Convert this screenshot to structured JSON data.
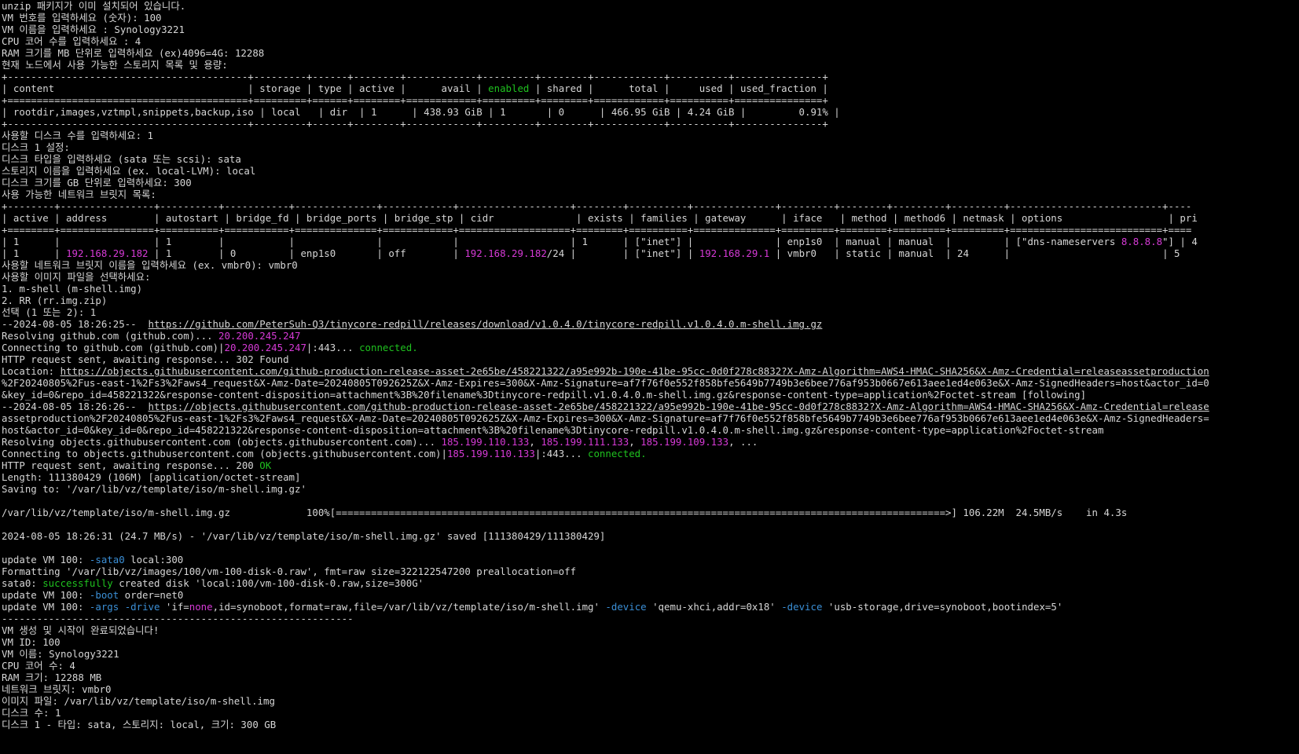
{
  "colors": {
    "background": "#000000",
    "text": "#d6d6d6",
    "magenta": "#d63ad6",
    "green": "#1fc21f",
    "blue": "#3b8fd6"
  },
  "lines": [
    [
      {
        "t": "unzip 패키지가 이미 설치되어 있습니다."
      }
    ],
    [
      {
        "t": "VM 번호를 입력하세요 (숫자): 100"
      }
    ],
    [
      {
        "t": "VM 이름을 입력하세요 : Synology3221"
      }
    ],
    [
      {
        "t": "CPU 코어 수를 입력하세요 : 4"
      }
    ],
    [
      {
        "t": "RAM 크기를 MB 단위로 입력하세요 (ex)4096=4G: 12288"
      }
    ],
    [
      {
        "t": "현재 노드에서 사용 가능한 스토리지 목록 및 용량:"
      }
    ],
    [
      {
        "t": "+-----------------------------------------+---------+------+--------+------------+---------+--------+------------+----------+---------------+"
      }
    ],
    [
      {
        "t": "| content                                 | storage | type | active |      avail | "
      },
      {
        "t": "enabled",
        "c": "green"
      },
      {
        "t": " | shared |      total |     used | used_fraction |"
      }
    ],
    [
      {
        "t": "+=========================================+=========+======+========+============+=========+========+============+==========+===============+"
      }
    ],
    [
      {
        "t": "| rootdir,images,vztmpl,snippets,backup,iso | local   | dir  | 1      | 438.93 GiB | 1       | 0      | 466.95 GiB | 4.24 GiB |         0.91% |"
      }
    ],
    [
      {
        "t": "+-----------------------------------------+---------+------+--------+------------+---------+--------+------------+----------+---------------+"
      }
    ],
    [
      {
        "t": "사용할 디스크 수를 입력하세요: 1"
      }
    ],
    [
      {
        "t": "디스크 1 설정:"
      }
    ],
    [
      {
        "t": "디스크 타입을 입력하세요 (sata 또는 scsi): sata"
      }
    ],
    [
      {
        "t": "스토리지 이름을 입력하세요 (ex. local-LVM): local"
      }
    ],
    [
      {
        "t": "디스크 크기를 GB 단위로 입력하세요: 300"
      }
    ],
    [
      {
        "t": "사용 가능한 네트워크 브릿지 목록:"
      }
    ],
    [
      {
        "t": "+--------+----------------+----------+-----------+--------------+------------+-------------------+--------+----------+--------------+---------+--------+---------+---------+--------------------------+----"
      }
    ],
    [
      {
        "t": "| active | address        | autostart | bridge_fd | bridge_ports | bridge_stp | cidr              | exists | families | gateway      | iface   | method | method6 | netmask | options                  | pri"
      }
    ],
    [
      {
        "t": "+========+================+==========+===========+==============+============+===================+========+==========+==============+=========+========+=========+=========+==========================+===="
      }
    ],
    [
      {
        "t": "| 1      |                | 1        |           |              |            |                   | 1      | [\"inet\"] |              | enp1s0  | manual | manual  |         | [\"dns-nameservers "
      },
      {
        "t": "8.8.8.8",
        "c": "magenta"
      },
      {
        "t": "\"] | 4"
      }
    ],
    [
      {
        "t": "| 1      | "
      },
      {
        "t": "192.168.29.182",
        "c": "magenta"
      },
      {
        "t": " | 1        | 0         | enp1s0       | off        | "
      },
      {
        "t": "192.168.29.182",
        "c": "magenta"
      },
      {
        "t": "/24 |        | [\"inet\"] | "
      },
      {
        "t": "192.168.29.1",
        "c": "magenta"
      },
      {
        "t": " | vmbr0   | static | manual  | 24      |                          | 5"
      }
    ],
    [
      {
        "t": "사용할 네트워크 브릿지 이름을 입력하세요 (ex. vmbr0): vmbr0"
      }
    ],
    [
      {
        "t": "사용할 이미지 파일을 선택하세요:"
      }
    ],
    [
      {
        "t": "1. m-shell (m-shell.img)"
      }
    ],
    [
      {
        "t": "2. RR (rr.img.zip)"
      }
    ],
    [
      {
        "t": "선택 (1 또는 2): 1"
      }
    ],
    [
      {
        "t": "--2024-08-05 18:26:25--  "
      },
      {
        "t": "https://github.com/PeterSuh-Q3/tinycore-redpill/releases/download/v1.0.4.0/tinycore-redpill.v1.0.4.0.m-shell.img.gz",
        "c": "url"
      }
    ],
    [
      {
        "t": "Resolving github.com (github.com)... "
      },
      {
        "t": "20.200.245.247",
        "c": "magenta"
      }
    ],
    [
      {
        "t": "Connecting to github.com (github.com)|"
      },
      {
        "t": "20.200.245.247",
        "c": "magenta"
      },
      {
        "t": "|:443... "
      },
      {
        "t": "connected.",
        "c": "green"
      }
    ],
    [
      {
        "t": "HTTP request sent, awaiting response... 302 Found"
      }
    ],
    [
      {
        "t": "Location: "
      },
      {
        "t": "https://objects.githubusercontent.com/github-production-release-asset-2e65be/458221322/a95e992b-190e-41be-95cc-0d0f278c8832?X-Amz-Algorithm=AWS4-HMAC-SHA256&X-Amz-Credential=releaseassetproduction",
        "c": "url"
      }
    ],
    [
      {
        "t": "%2F20240805%2Fus-east-1%2Fs3%2Faws4_request&X-Amz-Date=20240805T092625Z&X-Amz-Expires=300&X-Amz-Signature=af7f76f0e552f858bfe5649b7749b3e6bee776af953b0667e613aee1ed4e063e&X-Amz-SignedHeaders=host&actor_id=0"
      }
    ],
    [
      {
        "t": "&key_id=0&repo_id=458221322&response-content-disposition=attachment%3B%20filename%3Dtinycore-redpill.v1.0.4.0.m-shell.img.gz&response-content-type=application%2Foctet-stream [following]"
      }
    ],
    [
      {
        "t": "--2024-08-05 18:26:26--  "
      },
      {
        "t": "https://objects.githubusercontent.com/github-production-release-asset-2e65be/458221322/a95e992b-190e-41be-95cc-0d0f278c8832?X-Amz-Algorithm=AWS4-HMAC-SHA256&X-Amz-Credential=release",
        "c": "url"
      }
    ],
    [
      {
        "t": "assetproduction%2F20240805%2Fus-east-1%2Fs3%2Faws4_request&X-Amz-Date=20240805T092625Z&X-Amz-Expires=300&X-Amz-Signature=af7f76f0e552f858bfe5649b7749b3e6bee776af953b0667e613aee1ed4e063e&X-Amz-SignedHeaders="
      }
    ],
    [
      {
        "t": "host&actor_id=0&key_id=0&repo_id=458221322&response-content-disposition=attachment%3B%20filename%3Dtinycore-redpill.v1.0.4.0.m-shell.img.gz&response-content-type=application%2Foctet-stream"
      }
    ],
    [
      {
        "t": "Resolving objects.githubusercontent.com (objects.githubusercontent.com)... "
      },
      {
        "t": "185.199.110.133",
        "c": "magenta"
      },
      {
        "t": ", "
      },
      {
        "t": "185.199.111.133",
        "c": "magenta"
      },
      {
        "t": ", "
      },
      {
        "t": "185.199.109.133",
        "c": "magenta"
      },
      {
        "t": ", ..."
      }
    ],
    [
      {
        "t": "Connecting to objects.githubusercontent.com (objects.githubusercontent.com)|"
      },
      {
        "t": "185.199.110.133",
        "c": "magenta"
      },
      {
        "t": "|:443... "
      },
      {
        "t": "connected.",
        "c": "green"
      }
    ],
    [
      {
        "t": "HTTP request sent, awaiting response... 200 "
      },
      {
        "t": "OK",
        "c": "green"
      }
    ],
    [
      {
        "t": "Length: 111380429 (106M) [application/octet-stream]"
      }
    ],
    [
      {
        "t": "Saving to: '/var/lib/vz/template/iso/m-shell.img.gz'"
      }
    ],
    [
      {
        "t": ""
      }
    ],
    [
      {
        "t": "/var/lib/vz/template/iso/m-shell.img.gz             100%[========================================================================================================>] 106.22M  24.5MB/s    in 4.3s"
      }
    ],
    [
      {
        "t": ""
      }
    ],
    [
      {
        "t": "2024-08-05 18:26:31 (24.7 MB/s) - '/var/lib/vz/template/iso/m-shell.img.gz' saved [111380429/111380429]"
      }
    ],
    [
      {
        "t": ""
      }
    ],
    [
      {
        "t": "update VM 100: "
      },
      {
        "t": "-sata0",
        "c": "blue"
      },
      {
        "t": " local:300"
      }
    ],
    [
      {
        "t": "Formatting '/var/lib/vz/images/100/vm-100-disk-0.raw', fmt=raw size=322122547200 preallocation=off"
      }
    ],
    [
      {
        "t": "sata0: "
      },
      {
        "t": "successfully",
        "c": "green"
      },
      {
        "t": " created disk 'local:100/vm-100-disk-0.raw,size=300G'"
      }
    ],
    [
      {
        "t": "update VM 100: "
      },
      {
        "t": "-boot",
        "c": "blue"
      },
      {
        "t": " order=net0"
      }
    ],
    [
      {
        "t": "update VM 100: "
      },
      {
        "t": "-args",
        "c": "blue"
      },
      {
        "t": " "
      },
      {
        "t": "-drive",
        "c": "blue"
      },
      {
        "t": " 'if="
      },
      {
        "t": "none",
        "c": "magenta"
      },
      {
        "t": ",id=synoboot,format=raw,file=/var/lib/vz/template/iso/m-shell.img' "
      },
      {
        "t": "-device",
        "c": "blue"
      },
      {
        "t": " 'qemu-xhci,addr=0x18' "
      },
      {
        "t": "-device",
        "c": "blue"
      },
      {
        "t": " 'usb-storage,drive=synoboot,bootindex=5'"
      }
    ],
    [
      {
        "t": "------------------------------------------------------------"
      }
    ],
    [
      {
        "t": "VM 생성 및 시작이 완료되었습니다!"
      }
    ],
    [
      {
        "t": "VM ID: 100"
      }
    ],
    [
      {
        "t": "VM 이름: Synology3221"
      }
    ],
    [
      {
        "t": "CPU 코어 수: 4"
      }
    ],
    [
      {
        "t": "RAM 크기: 12288 MB"
      }
    ],
    [
      {
        "t": "네트워크 브릿지: vmbr0"
      }
    ],
    [
      {
        "t": "이미지 파일: /var/lib/vz/template/iso/m-shell.img"
      }
    ],
    [
      {
        "t": "디스크 수: 1"
      }
    ],
    [
      {
        "t": "디스크 1 - 타입: sata, 스토리지: local, 크기: 300 GB"
      }
    ]
  ]
}
